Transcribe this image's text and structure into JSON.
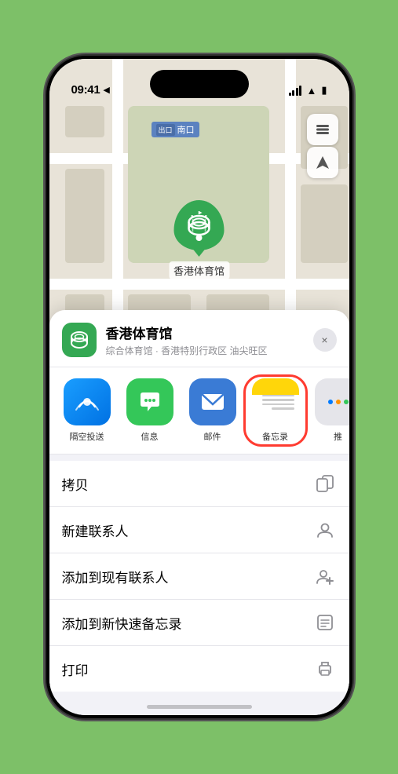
{
  "status_bar": {
    "time": "09:41",
    "location_arrow": "▶"
  },
  "map": {
    "label": "南口",
    "stadium_name": "香港体育馆"
  },
  "map_controls": {
    "layers_icon": "🗺",
    "location_icon": "⬆"
  },
  "sheet": {
    "venue_name": "香港体育馆",
    "venue_desc": "综合体育馆 · 香港特别行政区 油尖旺区",
    "close_label": "×"
  },
  "share_items": [
    {
      "id": "airdrop",
      "label": "隔空投送"
    },
    {
      "id": "messages",
      "label": "信息"
    },
    {
      "id": "mail",
      "label": "邮件"
    },
    {
      "id": "notes",
      "label": "备忘录"
    },
    {
      "id": "more",
      "label": "推"
    }
  ],
  "actions": [
    {
      "label": "拷贝",
      "icon": "copy"
    },
    {
      "label": "新建联系人",
      "icon": "person"
    },
    {
      "label": "添加到现有联系人",
      "icon": "person-add"
    },
    {
      "label": "添加到新快速备忘录",
      "icon": "quick-note"
    },
    {
      "label": "打印",
      "icon": "printer"
    }
  ]
}
